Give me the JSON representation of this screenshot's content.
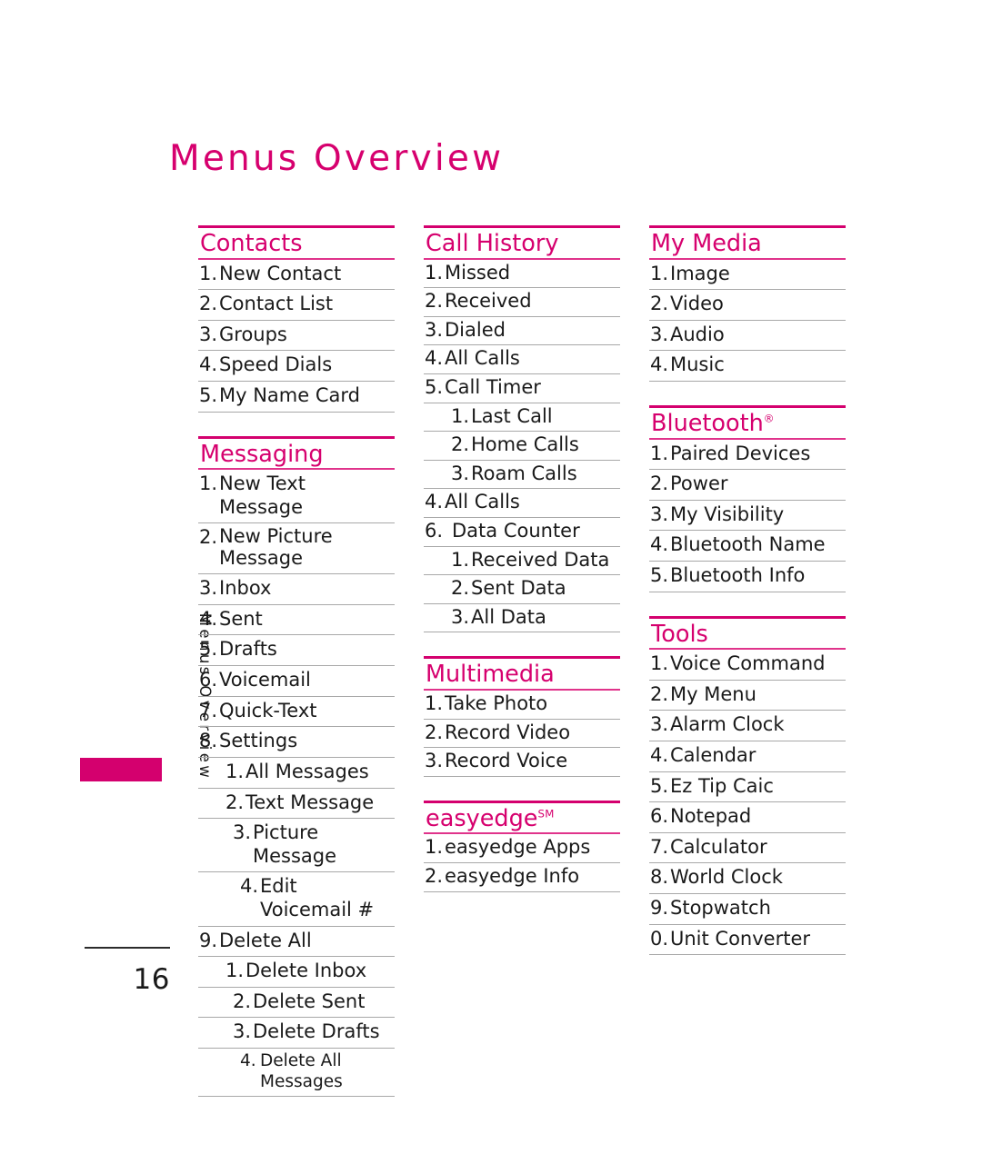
{
  "page": {
    "title": "Menus Overview",
    "side_tab_label": "Menus Overview",
    "page_number": "16",
    "accent_color": "#D4006E",
    "heading_color": "#D6006E",
    "rule_color": "#a8a8a8"
  },
  "columns": [
    {
      "sections": [
        {
          "heading": "Contacts",
          "items": [
            {
              "num": "1.",
              "text": "New Contact"
            },
            {
              "num": "2.",
              "text": "Contact List"
            },
            {
              "num": "3.",
              "text": "Groups"
            },
            {
              "num": "4.",
              "text": "Speed Dials"
            },
            {
              "num": "5.",
              "text": "My Name Card"
            }
          ]
        },
        {
          "heading": "Messaging",
          "items": [
            {
              "num": "1.",
              "text": "New Text Message"
            },
            {
              "num": "2.",
              "text": "New Picture Message"
            },
            {
              "num": "3.",
              "text": "Inbox"
            },
            {
              "num": "4.",
              "text": "Sent"
            },
            {
              "num": "5.",
              "text": "Drafts"
            },
            {
              "num": "6.",
              "text": "Voicemail"
            },
            {
              "num": "7.",
              "text": "Quick-Text"
            },
            {
              "num": "8.",
              "text": "Settings"
            },
            {
              "num": "1.",
              "text": "All Messages"
            },
            {
              "num": "2.",
              "text": "Text Message"
            },
            {
              "num": "3.",
              "text": "Picture Message"
            },
            {
              "num": "4.",
              "text": "Edit Voicemail #"
            },
            {
              "num": "9.",
              "text": "Delete All"
            },
            {
              "num": "1.",
              "text": "Delete Inbox"
            },
            {
              "num": "2.",
              "text": "Delete Sent"
            },
            {
              "num": "3.",
              "text": "Delete Drafts"
            },
            {
              "num": "4.",
              "text": "Delete All Messages"
            }
          ]
        }
      ]
    },
    {
      "sections": [
        {
          "heading": "Call History",
          "items": [
            {
              "num": "1.",
              "text": "Missed"
            },
            {
              "num": "2.",
              "text": "Received"
            },
            {
              "num": "3.",
              "text": "Dialed"
            },
            {
              "num": "4.",
              "text": "All Calls"
            },
            {
              "num": "5.",
              "text": "Call Timer"
            },
            {
              "num": "1.",
              "text": "Last Call"
            },
            {
              "num": "2.",
              "text": "Home Calls"
            },
            {
              "num": "3.",
              "text": "Roam Calls"
            },
            {
              "num": "4.",
              "text": "All Calls"
            },
            {
              "num": "6.",
              "text": "Data Counter"
            },
            {
              "num": "1.",
              "text": "Received Data"
            },
            {
              "num": "2.",
              "text": "Sent Data"
            },
            {
              "num": "3.",
              "text": "All Data"
            }
          ]
        },
        {
          "heading": "Multimedia",
          "items": [
            {
              "num": "1.",
              "text": "Take Photo"
            },
            {
              "num": "2.",
              "text": "Record Video"
            },
            {
              "num": "3.",
              "text": "Record Voice"
            }
          ]
        },
        {
          "heading": "easyedge",
          "heading_sup": "SM",
          "items": [
            {
              "num": "1.",
              "text": "easyedge Apps"
            },
            {
              "num": "2.",
              "text": "easyedge Info"
            }
          ]
        }
      ]
    },
    {
      "sections": [
        {
          "heading": "My Media",
          "items": [
            {
              "num": "1.",
              "text": "Image"
            },
            {
              "num": "2.",
              "text": "Video"
            },
            {
              "num": "3.",
              "text": "Audio"
            },
            {
              "num": "4.",
              "text": "Music"
            }
          ]
        },
        {
          "heading": "Bluetooth",
          "heading_sup": "®",
          "items": [
            {
              "num": "1.",
              "text": "Paired Devices"
            },
            {
              "num": "2.",
              "text": "Power"
            },
            {
              "num": "3.",
              "text": "My Visibility"
            },
            {
              "num": "4.",
              "text": "Bluetooth Name"
            },
            {
              "num": "5.",
              "text": "Bluetooth Info"
            }
          ]
        },
        {
          "heading": "Tools",
          "items": [
            {
              "num": "1.",
              "text": "Voice Command"
            },
            {
              "num": "2.",
              "text": "My Menu"
            },
            {
              "num": "3.",
              "text": "Alarm Clock"
            },
            {
              "num": "4.",
              "text": "Calendar"
            },
            {
              "num": "5.",
              "text": "Ez Tip Caic"
            },
            {
              "num": "6.",
              "text": "Notepad"
            },
            {
              "num": "7.",
              "text": "Calculator"
            },
            {
              "num": "8.",
              "text": "World Clock"
            },
            {
              "num": "9.",
              "text": "Stopwatch"
            },
            {
              "num": "0.",
              "text": "Unit Converter"
            }
          ]
        }
      ]
    }
  ]
}
